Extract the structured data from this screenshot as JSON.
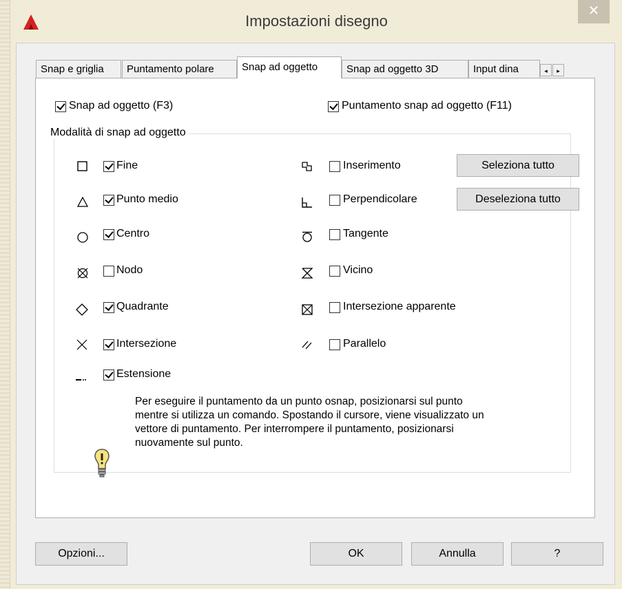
{
  "window": {
    "title": "Impostazioni disegno",
    "close": "✕"
  },
  "tabs": [
    {
      "label": "Snap e griglia"
    },
    {
      "label": "Puntamento polare"
    },
    {
      "label": "Snap ad oggetto"
    },
    {
      "label": "Snap ad oggetto 3D"
    },
    {
      "label": "Input dina"
    }
  ],
  "tab_scroll": {
    "left": "◂",
    "right": "▸"
  },
  "top_options": {
    "snap": {
      "label": "Snap ad oggetto (F3)",
      "checked": true
    },
    "tracking": {
      "label": "Puntamento snap ad oggetto (F11)",
      "checked": true
    }
  },
  "group": {
    "title": "Modalità di snap ad oggetto",
    "left": [
      {
        "label": "Fine",
        "checked": true,
        "icon": "square-endpoint-icon"
      },
      {
        "label": "Punto medio",
        "checked": true,
        "icon": "triangle-midpoint-icon"
      },
      {
        "label": "Centro",
        "checked": true,
        "icon": "circle-center-icon"
      },
      {
        "label": "Nodo",
        "checked": false,
        "icon": "node-icon"
      },
      {
        "label": "Quadrante",
        "checked": true,
        "icon": "diamond-quadrant-icon"
      },
      {
        "label": "Intersezione",
        "checked": true,
        "icon": "cross-intersection-icon"
      },
      {
        "label": "Estensione",
        "checked": true,
        "icon": "extension-icon"
      }
    ],
    "right": [
      {
        "label": "Inserimento",
        "checked": false,
        "icon": "insertion-icon"
      },
      {
        "label": "Perpendicolare",
        "checked": false,
        "icon": "perpendicular-icon"
      },
      {
        "label": "Tangente",
        "checked": false,
        "icon": "tangent-icon"
      },
      {
        "label": "Vicino",
        "checked": false,
        "icon": "nearest-icon"
      },
      {
        "label": "Intersezione apparente",
        "checked": false,
        "icon": "apparent-intersection-icon"
      },
      {
        "label": "Parallelo",
        "checked": false,
        "icon": "parallel-icon"
      }
    ],
    "select_all": "Seleziona tutto",
    "deselect_all": "Deseleziona tutto",
    "tip_lines": [
      "Per eseguire il puntamento da un punto osnap, posizionarsi sul punto",
      "mentre si utilizza un comando. Spostando il cursore, viene visualizzato un",
      "vettore di puntamento. Per interrompere il puntamento, posizionarsi",
      "nuovamente sul punto."
    ]
  },
  "footer": {
    "options": "Opzioni...",
    "ok": "OK",
    "cancel": "Annulla",
    "help": "?"
  }
}
